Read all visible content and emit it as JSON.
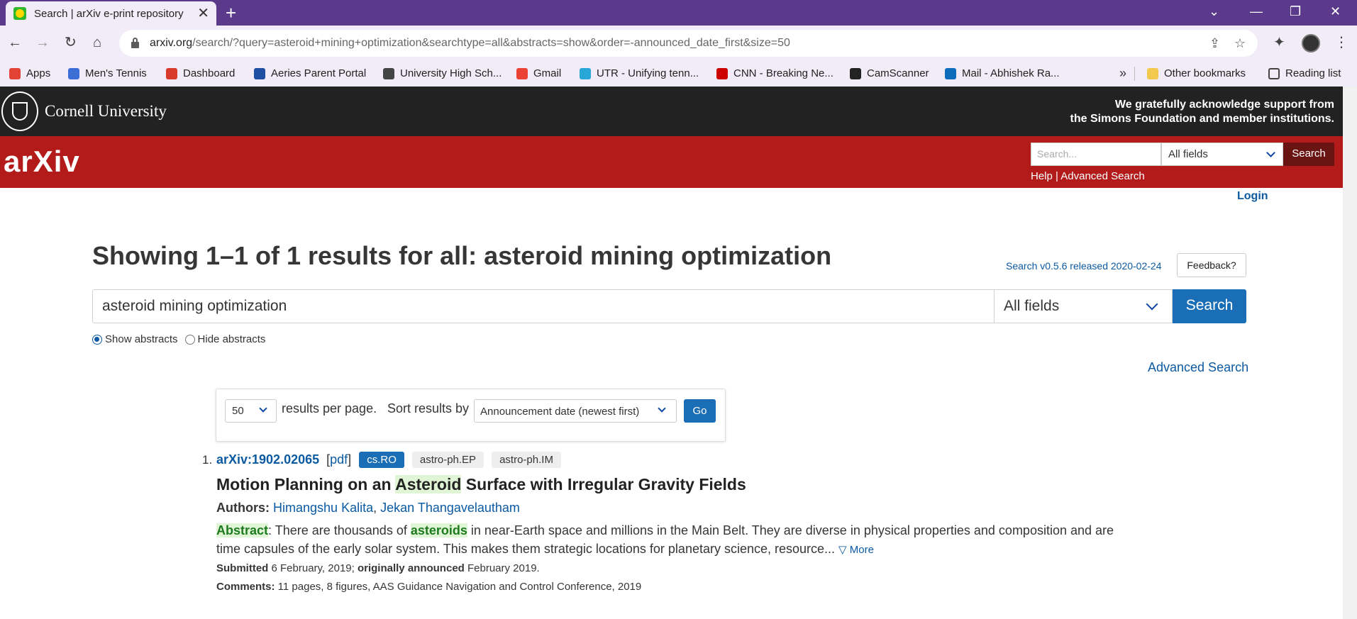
{
  "browser": {
    "tab_title": "Search | arXiv e-print repository",
    "tab_close": "✕",
    "new_tab": "+",
    "window_controls": {
      "dropdown": "⌄",
      "minimize": "—",
      "restore": "❐",
      "close": "✕"
    },
    "nav": {
      "back": "←",
      "forward": "→",
      "reload": "↻",
      "home": "⌂"
    },
    "url_host": "arxiv.org",
    "url_path": "/search/?query=asteroid+mining+optimization&searchtype=all&abstracts=show&order=-announced_date_first&size=50",
    "toolbar_icons": {
      "share": "⇪",
      "star": "☆",
      "extensions": "✦",
      "menu": "⋮"
    },
    "bookmarks": [
      {
        "label": "Apps",
        "color": "#e34234"
      },
      {
        "label": "Men's Tennis",
        "color": "#3b6fd6"
      },
      {
        "label": "Dashboard",
        "color": "#d83a2c"
      },
      {
        "label": "Aeries Parent Portal",
        "color": "#1e4fa3"
      },
      {
        "label": "University High Sch...",
        "color": "#444444"
      },
      {
        "label": "Gmail",
        "color": "#ea4335"
      },
      {
        "label": "UTR - Unifying tenn...",
        "color": "#27a6d8"
      },
      {
        "label": "CNN - Breaking Ne...",
        "color": "#cc0000"
      },
      {
        "label": "CamScanner",
        "color": "#222222"
      },
      {
        "label": "Mail - Abhishek Ra...",
        "color": "#0f6cbd"
      }
    ],
    "bookmarks_overflow": "»",
    "other_bookmarks": "Other bookmarks",
    "reading_list": "Reading list"
  },
  "header": {
    "university": "Cornell University",
    "support_line1": "We gratefully acknowledge support from",
    "support_line2": "the Simons Foundation and member institutions.",
    "logo": "arXiv",
    "search_placeholder": "Search...",
    "field_select": "All fields",
    "search_button": "Search",
    "help_links": "Help | Advanced Search",
    "login": "Login"
  },
  "search": {
    "heading": "Showing 1–1 of 1 results for all: asteroid mining optimization",
    "version": "Search v0.5.6 released 2020-02-24",
    "feedback": "Feedback?",
    "query": "asteroid mining optimization",
    "field": "All fields",
    "button": "Search",
    "show_abstracts": "Show abstracts",
    "hide_abstracts": "Hide abstracts",
    "advanced": "Advanced Search",
    "per_page": "50",
    "per_page_label": "results per page.",
    "sort_label": "Sort results by",
    "sort_value": "Announcement date (newest first)",
    "go": "Go"
  },
  "results": [
    {
      "number": "1.",
      "id": "arXiv:1902.02065",
      "pdf_open": "[",
      "pdf": "pdf",
      "pdf_close": "]",
      "tags": [
        "cs.RO",
        "astro-ph.EP",
        "astro-ph.IM"
      ],
      "title_before": "Motion Planning on an ",
      "title_highlight": "Asteroid",
      "title_after": " Surface with Irregular Gravity Fields",
      "authors_label": "Authors:",
      "author1": "Himangshu Kalita",
      "author_sep": ",",
      "author2": "Jekan Thangavelautham",
      "abstract_label": "Abstract",
      "abstract_part1": ": There are thousands of ",
      "abstract_highlight": "asteroids",
      "abstract_part2": " in near-Earth space and millions in the Main Belt. They are diverse in physical properties and composition and are time capsules of the early solar system. This makes them strategic locations for planetary science, resource... ",
      "more": "▽ More",
      "submitted_label": "Submitted",
      "submitted_date": " 6 February, 2019; ",
      "announced_label": "originally announced",
      "announced_date": " February 2019.",
      "comments_label": "Comments:",
      "comments": " 11 pages, 8 figures, AAS Guidance Navigation and Control Conference, 2019"
    }
  ]
}
